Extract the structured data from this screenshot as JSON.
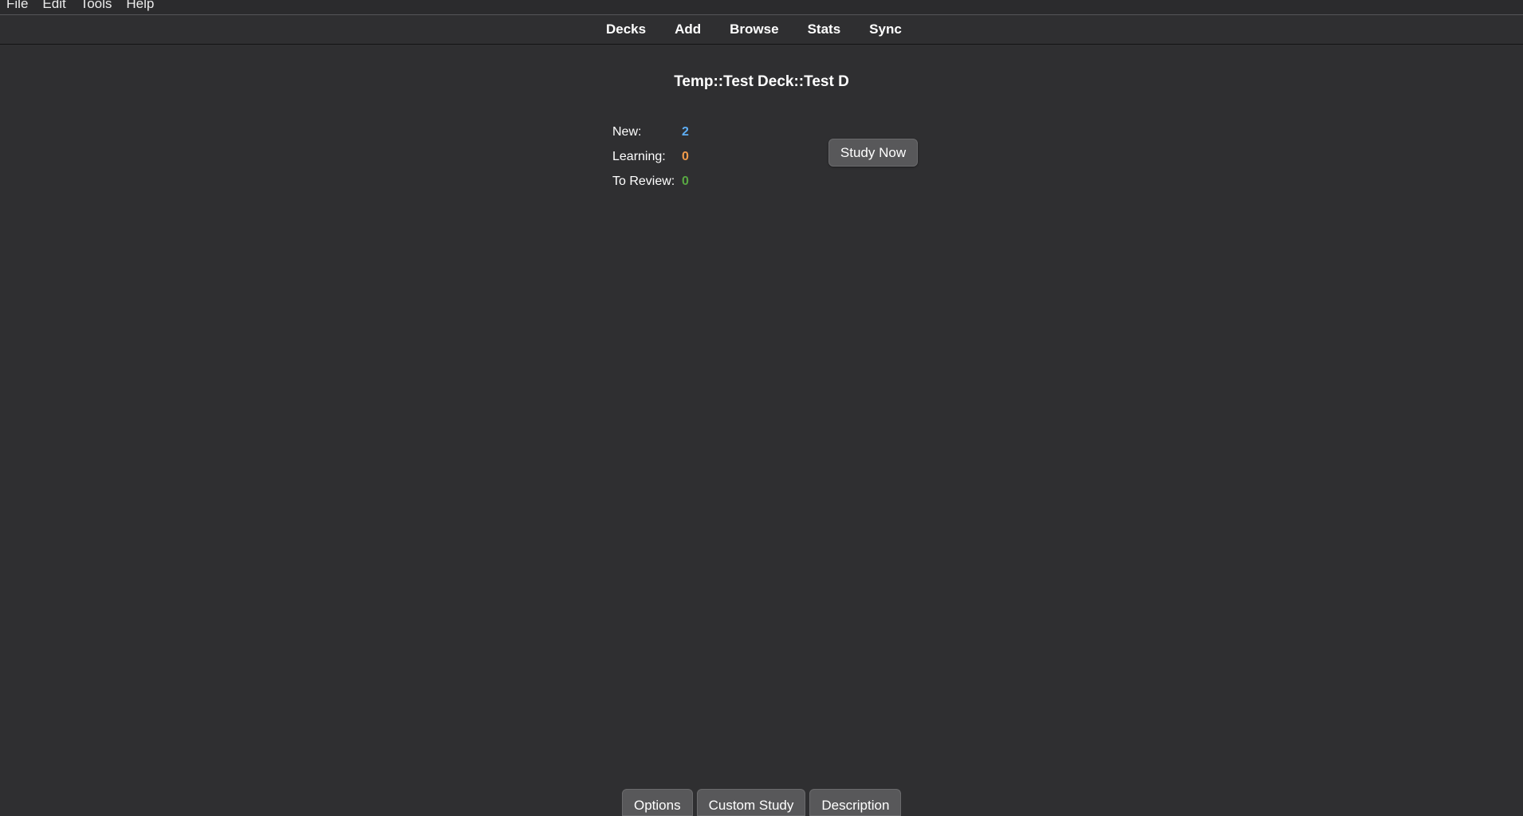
{
  "menubar": {
    "items": [
      {
        "label": "File"
      },
      {
        "label": "Edit"
      },
      {
        "label": "Tools"
      },
      {
        "label": "Help"
      }
    ]
  },
  "toolbar": {
    "links": [
      "Decks",
      "Add",
      "Browse",
      "Stats",
      "Sync"
    ]
  },
  "overview": {
    "deck_title": "Temp::Test Deck::Test D",
    "counts": {
      "new_label": "New:",
      "new_value": "2",
      "learning_label": "Learning:",
      "learning_value": "0",
      "review_label": "To Review:",
      "review_value": "0"
    },
    "study_button": "Study Now"
  },
  "bottom": {
    "options": "Options",
    "custom_study": "Custom Study",
    "description": "Description"
  },
  "colors": {
    "background": "#2f2f31",
    "new": "#5eaef5",
    "learning": "#f09a4a",
    "review": "#58a742",
    "button": "#58585a"
  }
}
